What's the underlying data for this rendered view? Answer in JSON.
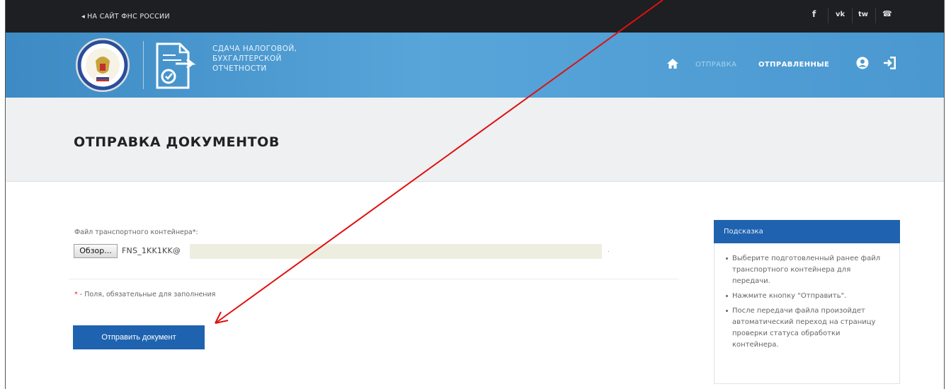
{
  "topbar": {
    "back_label": "НА САЙТ ФНС РОССИИ",
    "back_arrow": "◂",
    "social": {
      "facebook": "f",
      "vk": "vk",
      "twitter": "tw",
      "phone": "☎"
    }
  },
  "header": {
    "brand_line1": "СДАЧА НАЛОГОВОЙ,",
    "brand_line2": "БУХГАЛТЕРСКОЙ",
    "brand_line3": "ОТЧЕТНОСТИ",
    "nav_send": "ОТПРАВКА",
    "nav_sent": "ОТПРАВЛЕННЫЕ",
    "icons": [
      "emblem-icon",
      "document-icon",
      "home-icon",
      "user-icon",
      "logout-icon"
    ]
  },
  "page": {
    "title": "ОТПРАВКА ДОКУМЕНТОВ"
  },
  "form": {
    "field_label": "Файл транспортного контейнера*:",
    "browse_label": "Обзор...",
    "file_value": "FNS_1KK1KK@",
    "required_star": "*",
    "required_note": " - Поля, обязательные для заполнения",
    "submit_label": "Отправить документ"
  },
  "hint": {
    "title": "Подсказка",
    "items": [
      "Выберите подготовленный ранее файл транспортного контейнера для передачи.",
      "Нажмите кнопку \"Отправить\".",
      "После передачи файла произойдет автоматический переход на страницу проверки статуса обработки контейнера."
    ]
  },
  "colors": {
    "topbar": "#1d1f22",
    "header_blue": "#4a98d0",
    "button_blue": "#1f63b0",
    "annotation_red": "#e01010"
  }
}
